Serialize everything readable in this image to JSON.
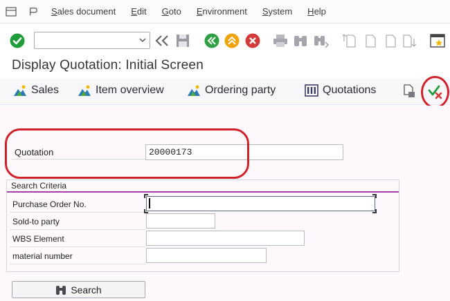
{
  "menu": {
    "items": [
      "Sales document",
      "Edit",
      "Goto",
      "Environment",
      "System",
      "Help"
    ]
  },
  "toolbar": {
    "command_field_value": "",
    "icons": [
      "enter-icon",
      "back-double-icon",
      "save-icon",
      "back-icon",
      "exit-icon",
      "cancel-icon",
      "print-icon",
      "find-icon",
      "find-next-icon",
      "first-page-icon",
      "previous-page-icon",
      "next-page-icon",
      "last-page-icon",
      "customize-layout-icon"
    ]
  },
  "title": "Display Quotation: Initial Screen",
  "app_toolbar": {
    "sales": "Sales",
    "item_overview": "Item overview",
    "ordering_party": "Ordering party",
    "quotations": "Quotations"
  },
  "quotation": {
    "label": "Quotation",
    "value": "20000173"
  },
  "search_criteria": {
    "title": "Search Criteria",
    "fields": [
      {
        "label": "Purchase Order No.",
        "value": ""
      },
      {
        "label": "Sold-to party",
        "value": ""
      },
      {
        "label": "WBS Element",
        "value": ""
      },
      {
        "label": "material number",
        "value": ""
      }
    ]
  },
  "search_button": "Search",
  "colors": {
    "highlight_ring": "#d0202a",
    "group_divider": "#a33ea6",
    "enter_green": "#1f9d3a",
    "nav_green": "#2ea043",
    "nav_orange": "#f0a30a",
    "nav_red": "#d43a3a"
  }
}
